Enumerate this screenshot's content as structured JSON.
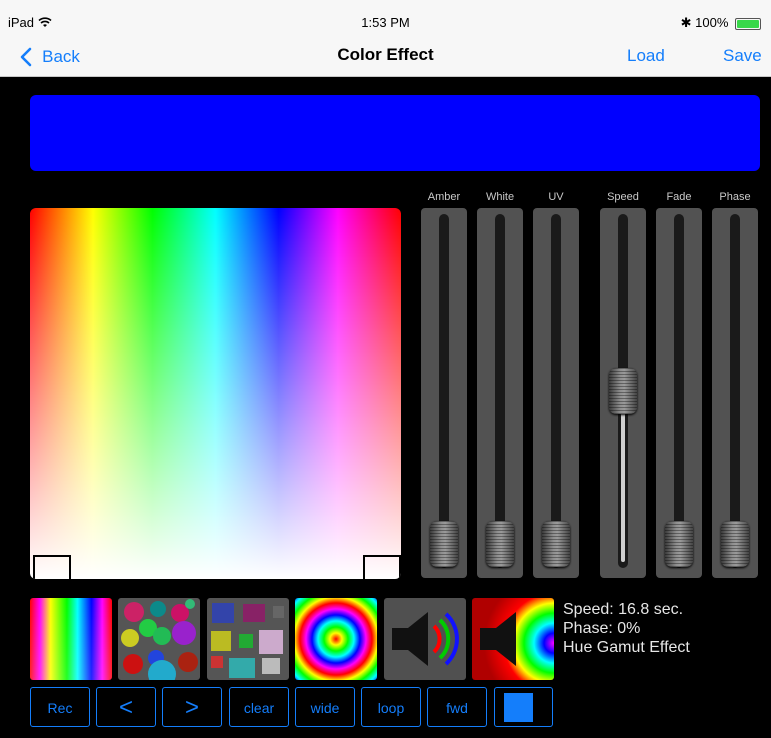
{
  "status_bar": {
    "device": "iPad",
    "time": "1:53 PM",
    "battery": "100%"
  },
  "nav": {
    "back_label": "Back",
    "title": "Color Effect",
    "load_label": "Load",
    "save_label": "Save"
  },
  "preview": {
    "color": "#0000ff"
  },
  "sliders": [
    {
      "label": "Amber",
      "value": 0.0
    },
    {
      "label": "White",
      "value": 0.0
    },
    {
      "label": "UV",
      "value": 0.0
    },
    {
      "label": "Speed",
      "value": 0.5
    },
    {
      "label": "Fade",
      "value": 0.0
    },
    {
      "label": "Phase",
      "value": 0.0
    }
  ],
  "info": {
    "speed": "Speed: 16.8 sec.",
    "phase": "Phase: 0%",
    "effect": "Hue Gamut Effect"
  },
  "buttons": {
    "rec": "Rec",
    "prev": "<",
    "next": ">",
    "clear": "clear",
    "wide": "wide",
    "loop": "loop",
    "fwd": "fwd"
  },
  "colors": {
    "accent": "#147efb",
    "background": "#000000",
    "slider_track": "#525252",
    "swatch": "#147efb"
  }
}
